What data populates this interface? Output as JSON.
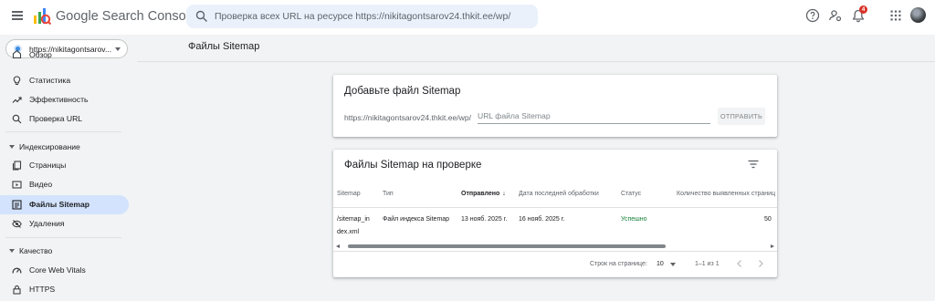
{
  "header": {
    "app_title": "Google Search Console",
    "search_placeholder": "Проверка всех URL на ресурсе https://nikitagontsarov24.thkit.ee/wp/",
    "notification_count": "4",
    "icons": [
      "menu-icon",
      "search-console-logo",
      "search-icon",
      "help-icon",
      "manage-users-icon",
      "notifications-icon",
      "apps-icon",
      "account-avatar"
    ]
  },
  "sidebar": {
    "property": "https://nikitagontsarov...",
    "partial_top_item": "Обзор",
    "items": [
      {
        "label": "Статистика",
        "icon": "lightbulb-icon"
      },
      {
        "label": "Эффективность",
        "icon": "trending-up-icon"
      },
      {
        "label": "Проверка URL",
        "icon": "search-icon"
      }
    ],
    "indexing_section": "Индексирование",
    "indexing_items": [
      {
        "label": "Страницы",
        "icon": "pages-icon"
      },
      {
        "label": "Видео",
        "icon": "video-icon"
      },
      {
        "label": "Файлы Sitemap",
        "icon": "sitemap-icon",
        "active": true
      },
      {
        "label": "Удаления",
        "icon": "removals-icon"
      }
    ],
    "quality_section": "Качество",
    "quality_items": [
      {
        "label": "Core Web Vitals",
        "icon": "speed-icon"
      },
      {
        "label": "HTTPS",
        "icon": "lock-icon"
      }
    ]
  },
  "main": {
    "page_title": "Файлы Sitemap",
    "add_card": {
      "title": "Добавьте файл Sitemap",
      "url_prefix": "https://nikitagontsarov24.thkit.ee/wp/",
      "input_placeholder": "URL файла Sitemap",
      "submit_label": "ОТПРАВИТЬ"
    },
    "table_card": {
      "title": "Файлы Sitemap на проверке",
      "columns": [
        "Sitemap",
        "Тип",
        "Отправлено",
        "Дата последней обработки",
        "Статус",
        "Количество выявленных страниц"
      ],
      "sorted_column": "Отправлено",
      "sort_arrow": "↓",
      "rows": [
        {
          "sitemap_line1": "/sitemap_in",
          "sitemap_line2": "dex.xml",
          "type": "Файл индекса Sitemap",
          "submitted": "13 нояб. 2025 г.",
          "last_read": "16 нояб. 2025 г.",
          "status": "Успешно",
          "discovered_pages": "50"
        }
      ],
      "pagination": {
        "rows_per_page_label": "Строк на странице:",
        "rows_per_page_value": "10",
        "range": "1–1 из 1"
      }
    }
  },
  "colors": {
    "accent_active": "#d3e3fd",
    "status_success": "#188038",
    "badge": "#d93025",
    "search_bg": "#eaf1fb"
  }
}
